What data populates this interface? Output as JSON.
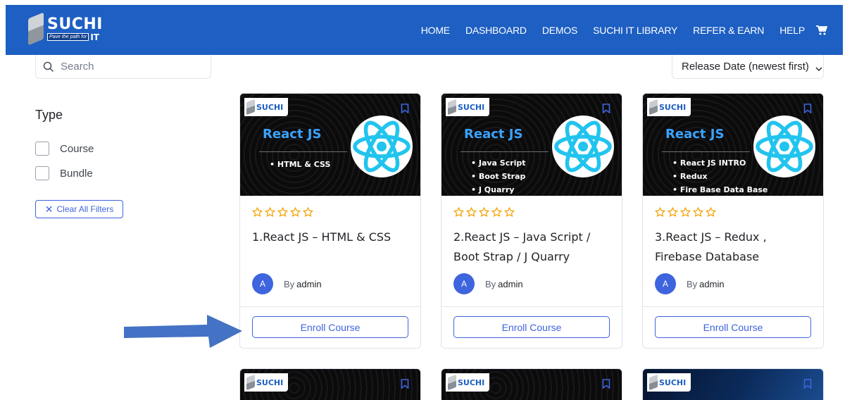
{
  "header": {
    "logo": {
      "word": "SUCHI",
      "tagline": "Pave the path for",
      "suffix": "IT"
    },
    "nav": [
      "HOME",
      "DASHBOARD",
      "DEMOS",
      "SUCHI IT LIBRARY",
      "REFER & EARN",
      "HELP"
    ],
    "colors": {
      "bar": "#1d5fc2"
    }
  },
  "sidebar": {
    "search_placeholder": "Search",
    "type_heading": "Type",
    "filters": [
      "Course",
      "Bundle"
    ],
    "clear_filters_label": "Clear All Filters"
  },
  "sort": {
    "selected": "Release Date (newest first)"
  },
  "courses": [
    {
      "thumb_logo": "SUCHI",
      "thumb_title": "React JS",
      "thumb_points": [
        "• HTML & CSS"
      ],
      "rating": 0,
      "title": "1.React JS – HTML & CSS",
      "author_initial": "A",
      "author_prefix": "By",
      "author_name": "admin",
      "enroll_label": "Enroll Course"
    },
    {
      "thumb_logo": "SUCHI",
      "thumb_title": "React JS",
      "thumb_points": [
        "• Java Script",
        "• Boot Strap",
        "• J Quarry"
      ],
      "rating": 0,
      "title": "2.React JS – Java Script / Boot Strap / J Quarry",
      "author_initial": "A",
      "author_prefix": "By",
      "author_name": "admin",
      "enroll_label": "Enroll Course"
    },
    {
      "thumb_logo": "SUCHI",
      "thumb_title": "React JS",
      "thumb_points": [
        "• React JS INTRO",
        "• Redux",
        "• Fire Base Data Base"
      ],
      "rating": 0,
      "title": "3.React JS – Redux , Firebase Database",
      "author_initial": "A",
      "author_prefix": "By",
      "author_name": "admin",
      "enroll_label": "Enroll Course"
    }
  ],
  "next_row_logos": [
    "SUCHI",
    "SUCHI",
    "SUCHI"
  ],
  "accent": "#3e64de",
  "star_color": "#f4a100",
  "annotation_arrow_color": "#4472c4"
}
